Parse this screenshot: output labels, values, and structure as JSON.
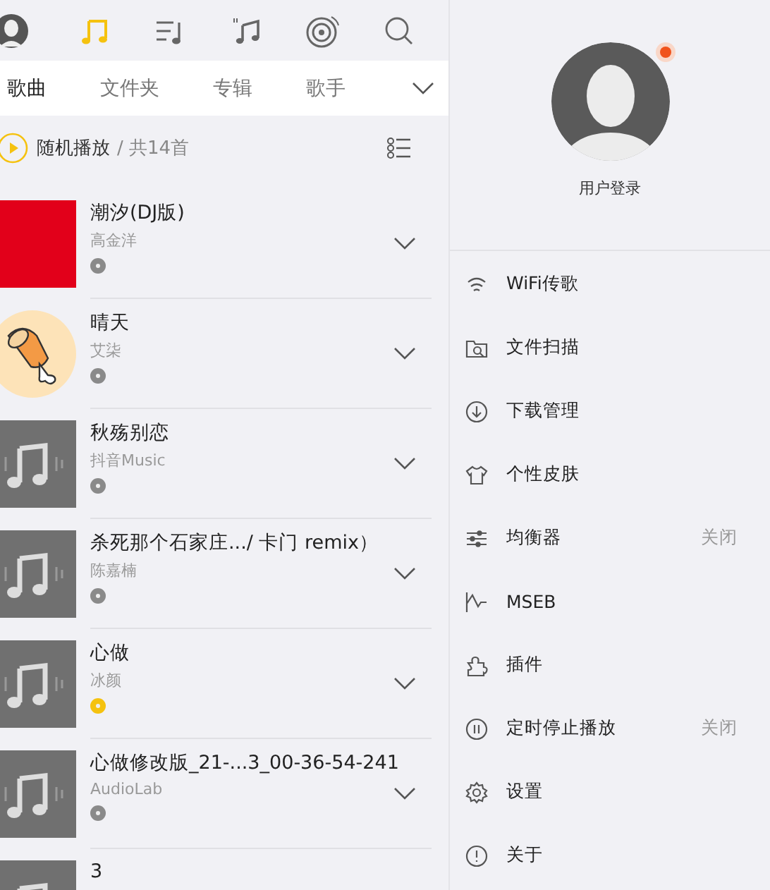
{
  "nav_icons": [
    {
      "kind": "avatar",
      "selected": false
    },
    {
      "kind": "note",
      "selected": true
    },
    {
      "kind": "playlist",
      "selected": false
    },
    {
      "kind": "hq",
      "selected": false
    },
    {
      "kind": "disc",
      "selected": false
    },
    {
      "kind": "search",
      "selected": false
    }
  ],
  "tabs": [
    {
      "label": "歌曲",
      "selected": true
    },
    {
      "label": "文件夹",
      "selected": false
    },
    {
      "label": "专辑",
      "selected": false
    },
    {
      "label": "歌手",
      "selected": false
    }
  ],
  "play_bar": {
    "label": "随机播放",
    "count": "/ 共14首"
  },
  "songs": [
    {
      "title": "潮汐(DJ版)",
      "artist": "高金洋",
      "kind": "red",
      "color": "#8a8a8a"
    },
    {
      "title": "晴天",
      "artist": "艾柒",
      "kind": "drumstick",
      "color": "#8a8a8a"
    },
    {
      "title": "秋殇别恋",
      "artist": "抖音Music",
      "kind": "note",
      "color": "#8a8a8a"
    },
    {
      "title": "杀死那个石家庄.../ 卡门 remix）",
      "artist": "陈嘉楠",
      "kind": "note",
      "color": "#8a8a8a"
    },
    {
      "title": "心做",
      "artist": "冰颜",
      "kind": "note",
      "color": "#f5c20f"
    },
    {
      "title": "心做修改版_21-...3_00-36-54-241",
      "artist": "AudioLab",
      "kind": "note",
      "color": "#8a8a8a"
    },
    {
      "title": "3",
      "kind": "note"
    }
  ],
  "drawer": {
    "login": "用户登录",
    "notification": true,
    "items": [
      {
        "kind": "wifi",
        "label": "WiFi传歌"
      },
      {
        "kind": "scan",
        "label": "文件扫描"
      },
      {
        "kind": "download",
        "label": "下载管理"
      },
      {
        "kind": "shirt",
        "label": "个性皮肤"
      },
      {
        "kind": "equalizer",
        "label": "均衡器",
        "value": "关闭"
      },
      {
        "kind": "wave",
        "label": "MSEB"
      },
      {
        "kind": "plugin",
        "label": "插件"
      },
      {
        "kind": "timer",
        "label": "定时停止播放",
        "value": "关闭"
      },
      {
        "kind": "settings",
        "label": "设置"
      },
      {
        "kind": "info",
        "label": "关于"
      }
    ]
  }
}
